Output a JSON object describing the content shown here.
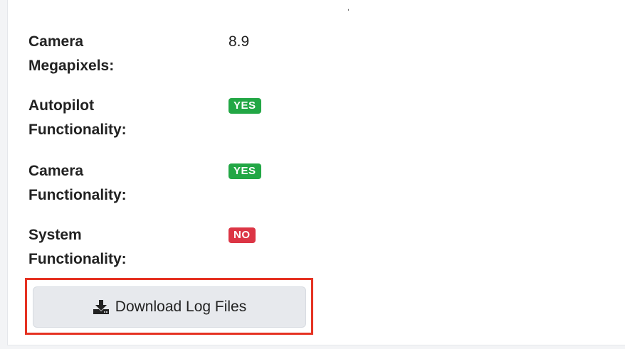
{
  "rows": [
    {
      "label": "Camera Megapixels:",
      "value": "8.9"
    },
    {
      "label": "Autopilot Functionality:",
      "badge": "YES"
    },
    {
      "label": "Camera Functionality:",
      "badge": "YES"
    },
    {
      "label": "System Functionality:",
      "badge": "NO"
    }
  ],
  "download": {
    "label": "Download Log Files",
    "icon": "download-icon"
  },
  "colors": {
    "yes_badge": "#22a745",
    "no_badge": "#dc3545",
    "highlight": "#e53222"
  }
}
